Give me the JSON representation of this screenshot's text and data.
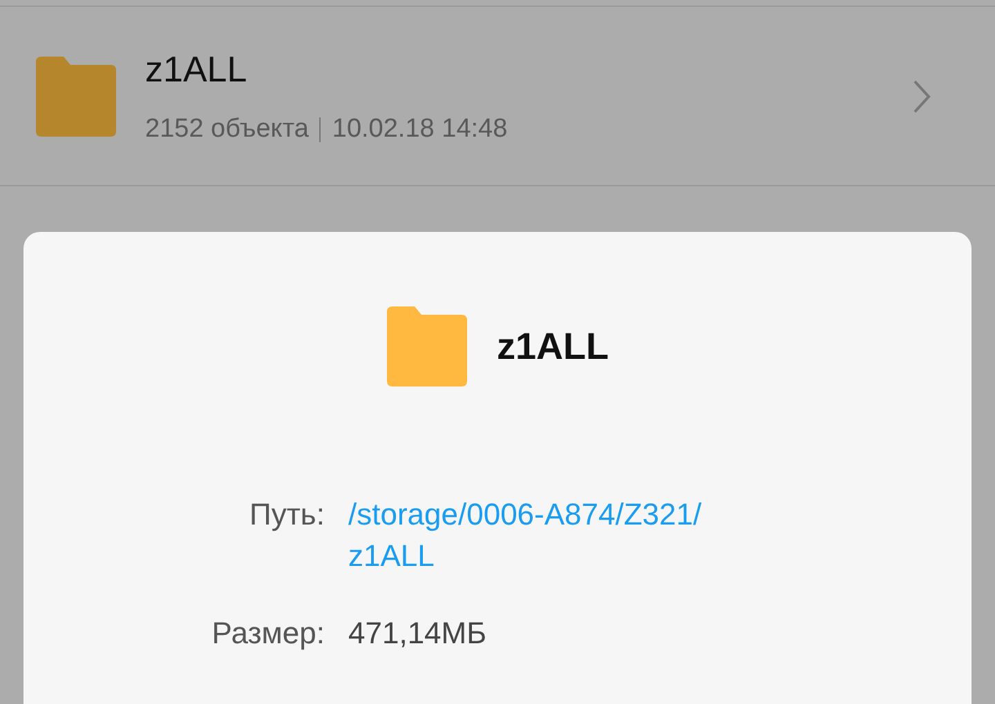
{
  "folder_row": {
    "name": "z1ALL",
    "count": "2152 объекта",
    "date": "10.02.18 14:48"
  },
  "details_sheet": {
    "title": "z1ALL",
    "properties": [
      {
        "label": "Путь:",
        "value_lines": [
          "/storage/0006-A874/Z321/",
          "z1ALL"
        ],
        "kind": "link"
      },
      {
        "label": "Размер:",
        "value_lines": [
          "471,14МБ"
        ],
        "kind": "text"
      }
    ]
  }
}
